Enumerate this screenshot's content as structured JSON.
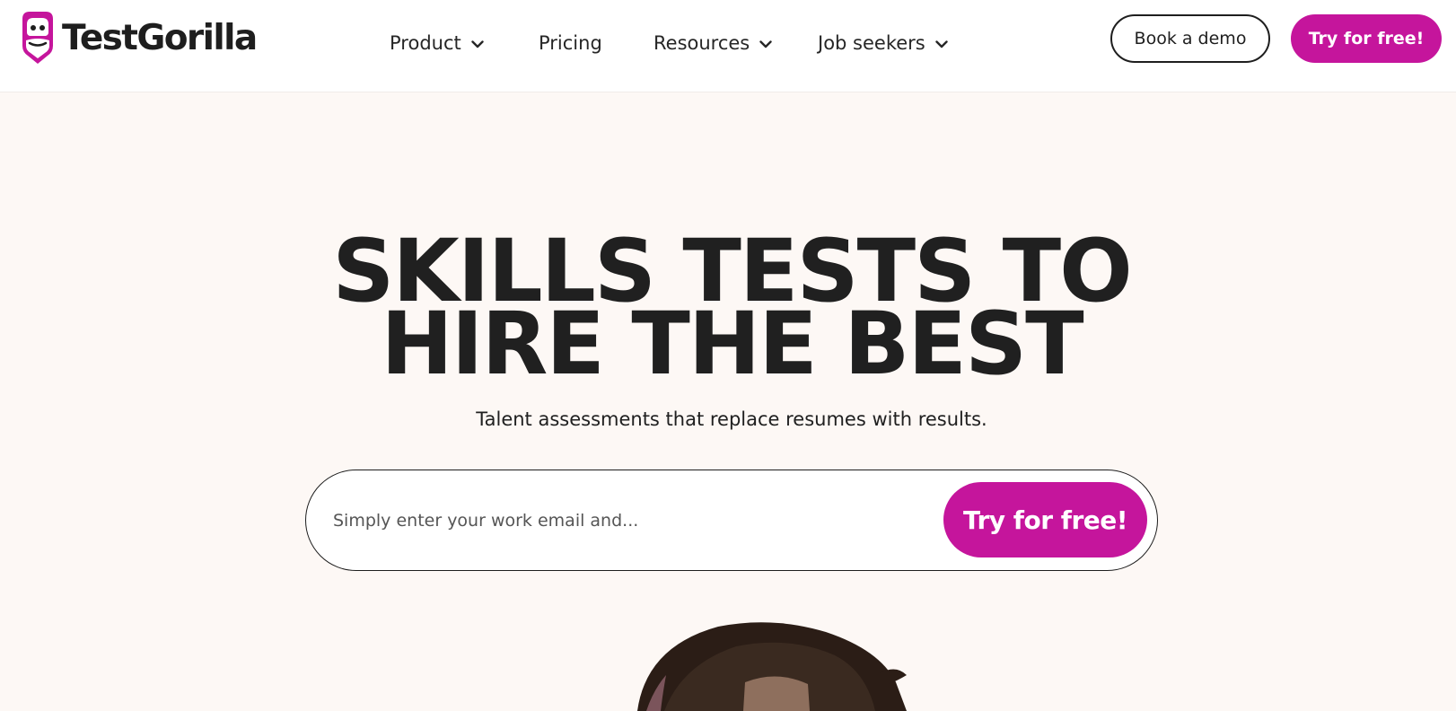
{
  "header": {
    "brand": "TestGorilla",
    "nav": [
      {
        "label": "Product",
        "has_dropdown": true
      },
      {
        "label": "Pricing",
        "has_dropdown": false
      },
      {
        "label": "Resources",
        "has_dropdown": true
      },
      {
        "label": "Job seekers",
        "has_dropdown": true
      }
    ],
    "book_demo_label": "Book a demo",
    "try_free_label": "Try for free!"
  },
  "hero": {
    "title_line1": "SKILLS TESTS TO",
    "title_line2": "HIRE THE BEST",
    "subtitle": "Talent assessments that replace resumes with results.",
    "email_placeholder": "Simply enter your work email and...",
    "cta_label": "Try for free!"
  },
  "icons": {
    "logo": "gorilla-shield-logo",
    "dropdown": "chevron-down-icon"
  },
  "colors": {
    "brand": "#c5159c",
    "text": "#202020",
    "hero_background": "#fdf8f5",
    "header_background": "#ffffff"
  }
}
